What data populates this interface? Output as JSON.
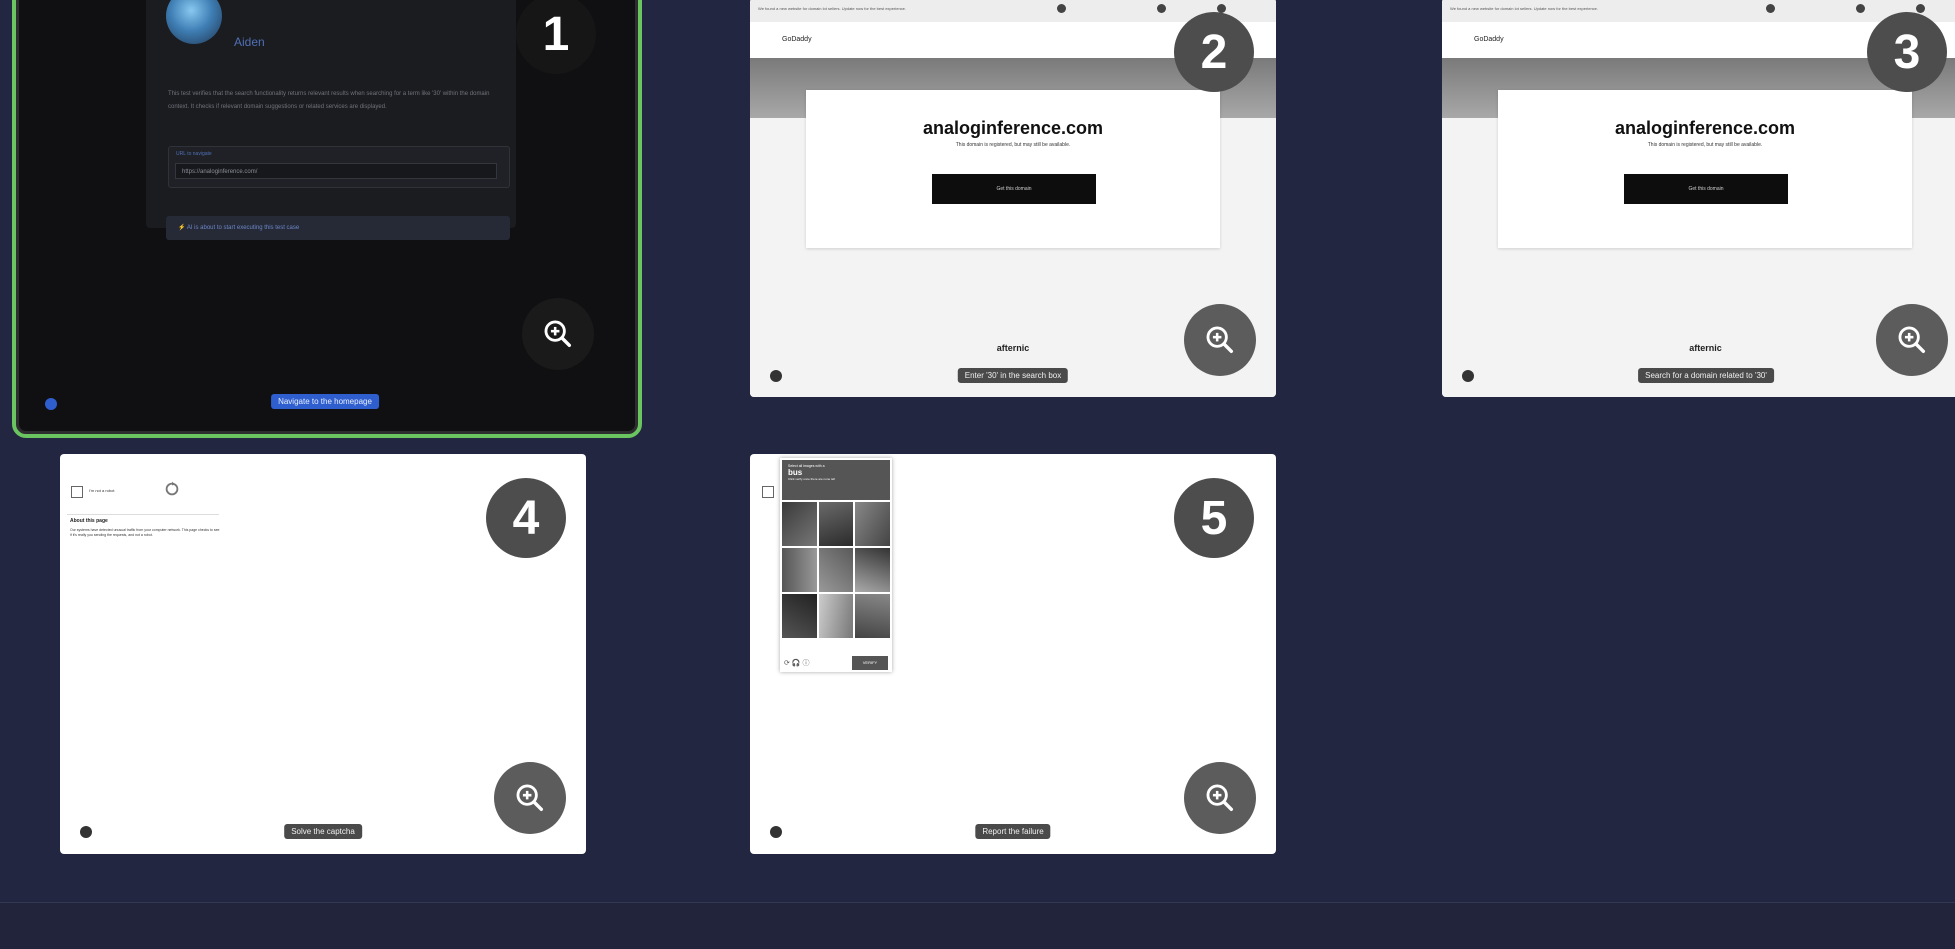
{
  "cards": [
    {
      "step": "1",
      "user_name": "Aiden",
      "description": "This test verifies that the search functionality returns relevant results when searching for a term like '30' within the domain context. It checks if relevant domain suggestions or related services are displayed.",
      "url_label": "URL to navigate",
      "url_value": "https://analoginference.com/",
      "status": "AI is about to start executing this test case",
      "action": "Navigate to the homepage"
    },
    {
      "step": "2",
      "domain": "analoginference.com",
      "subtitle": "This domain is registered, but may still be available.",
      "button": "Get this domain",
      "brand": "GoDaddy",
      "afternic": "afternic",
      "warning": "We found a new website for domain lot sellers. Update now for the best experience.",
      "action": "Enter '30' in the search box"
    },
    {
      "step": "3",
      "domain": "analoginference.com",
      "subtitle": "This domain is registered, but may still be available.",
      "button": "Get this domain",
      "brand": "GoDaddy",
      "afternic": "afternic",
      "warning": "We found a new website for domain lot sellers. Update now for the best experience.",
      "action": "Search for a domain related to '30'"
    },
    {
      "step": "4",
      "checkbox_label": "I'm not a robot",
      "about_title": "About this page",
      "about_text": "Our systems have detected unusual traffic from your computer network. This page checks to see if it's really you sending the requests, and not a robot.",
      "action": "Solve the captcha"
    },
    {
      "step": "5",
      "challenge_small": "Select all images with a",
      "challenge_big": "bus",
      "challenge_hint": "Click verify once there are none left",
      "verify": "VERIFY",
      "action": "Report the failure"
    }
  ],
  "icons": {
    "zoom": "zoom-in-icon",
    "info": "info-icon"
  },
  "colors": {
    "background": "#232640",
    "active_border": "#6ac45f",
    "badge": "#4d4d4d",
    "accent_blue": "#2f5fcf"
  }
}
